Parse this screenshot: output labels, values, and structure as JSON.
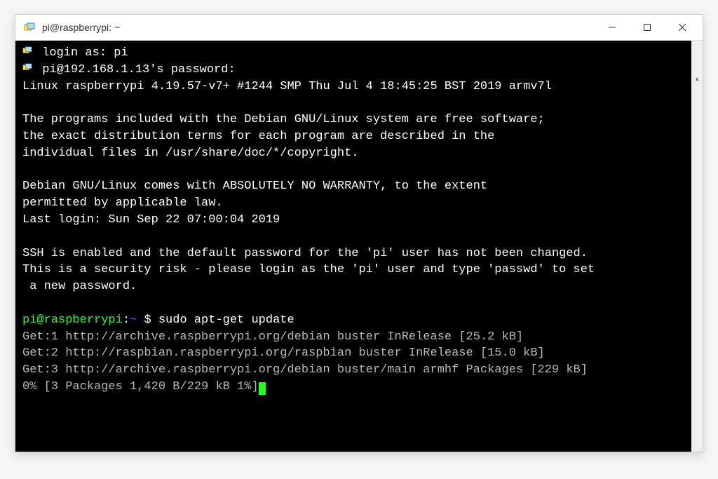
{
  "window": {
    "title": "pi@raspberrypi: ~"
  },
  "terminal": {
    "login_prompt": "login as:",
    "login_value": "pi",
    "password_prompt": "pi@192.168.1.13's password:",
    "system_line": "Linux raspberrypi 4.19.57-v7+ #1244 SMP Thu Jul 4 18:45:25 BST 2019 armv7l",
    "motd_line1": "The programs included with the Debian GNU/Linux system are free software;",
    "motd_line2": "the exact distribution terms for each program are described in the",
    "motd_line3": "individual files in /usr/share/doc/*/copyright.",
    "motd_line4": "Debian GNU/Linux comes with ABSOLUTELY NO WARRANTY, to the extent",
    "motd_line5": "permitted by applicable law.",
    "last_login": "Last login: Sun Sep 22 07:00:04 2019",
    "ssh_warn1": "SSH is enabled and the default password for the 'pi' user has not been changed.",
    "ssh_warn2": "This is a security risk - please login as the 'pi' user and type 'passwd' to set",
    "ssh_warn3": " a new password.",
    "prompt_user": "pi@raspberrypi",
    "prompt_colon": ":",
    "prompt_tilde": "~",
    "prompt_dollar": "$",
    "command": "sudo apt-get update",
    "apt_get1": "Get:1 http://archive.raspberrypi.org/debian buster InRelease [25.2 kB]",
    "apt_get2": "Get:2 http://raspbian.raspberrypi.org/raspbian buster InRelease [15.0 kB]",
    "apt_get3": "Get:3 http://archive.raspberrypi.org/debian buster/main armhf Packages [229 kB]",
    "apt_progress": "0% [3 Packages 1,420 B/229 kB 1%]"
  }
}
